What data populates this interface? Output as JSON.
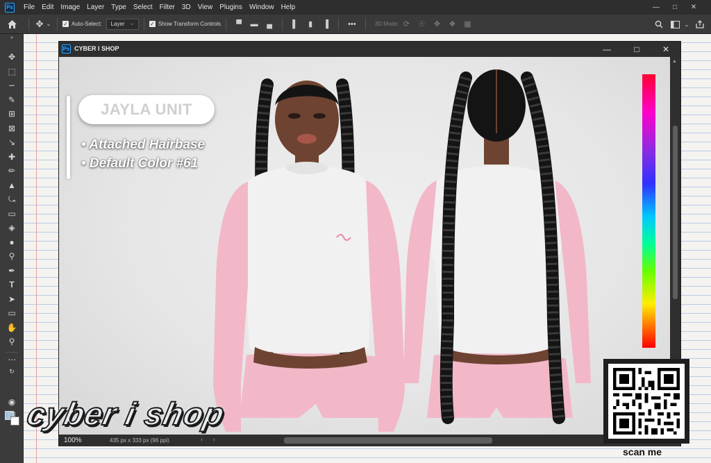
{
  "app": {
    "logo_text": "Ps",
    "menu": [
      "File",
      "Edit",
      "Image",
      "Layer",
      "Type",
      "Select",
      "Filter",
      "3D",
      "View",
      "Plugins",
      "Window",
      "Help"
    ],
    "window_controls": [
      "minimize-icon",
      "restore-icon",
      "close-icon"
    ]
  },
  "options_bar": {
    "auto_select_label": "Auto-Select:",
    "auto_select_checked": true,
    "auto_select_target": "Layer",
    "transform_controls_label": "Show Transform Controls",
    "transform_controls_checked": true,
    "more_label": "•••",
    "mode_3d_label": "3D Mode:"
  },
  "document": {
    "title": "CYBER I SHOP",
    "zoom": "100%",
    "dimensions": "435 px x 333 px (96 ppi)",
    "vscroll_fraction": 0.27,
    "hscroll_fraction": 0.27
  },
  "artwork": {
    "badge_title": "JAYLA UNIT",
    "features": [
      "• Attached Hairbase",
      "• Default Color #61"
    ],
    "watermark_text": "cyber i shop",
    "qr_caption": "scan me"
  },
  "colors": {
    "app_dark": "#2e2e2e",
    "panel": "#3b3b3b",
    "accent_blue": "#31a8ff",
    "top_pink": "#f2b8c8",
    "top_white": "#f1f1f1",
    "hair": "#141414",
    "skin": "#6e4332",
    "paper_line": "#b9cbe4"
  }
}
